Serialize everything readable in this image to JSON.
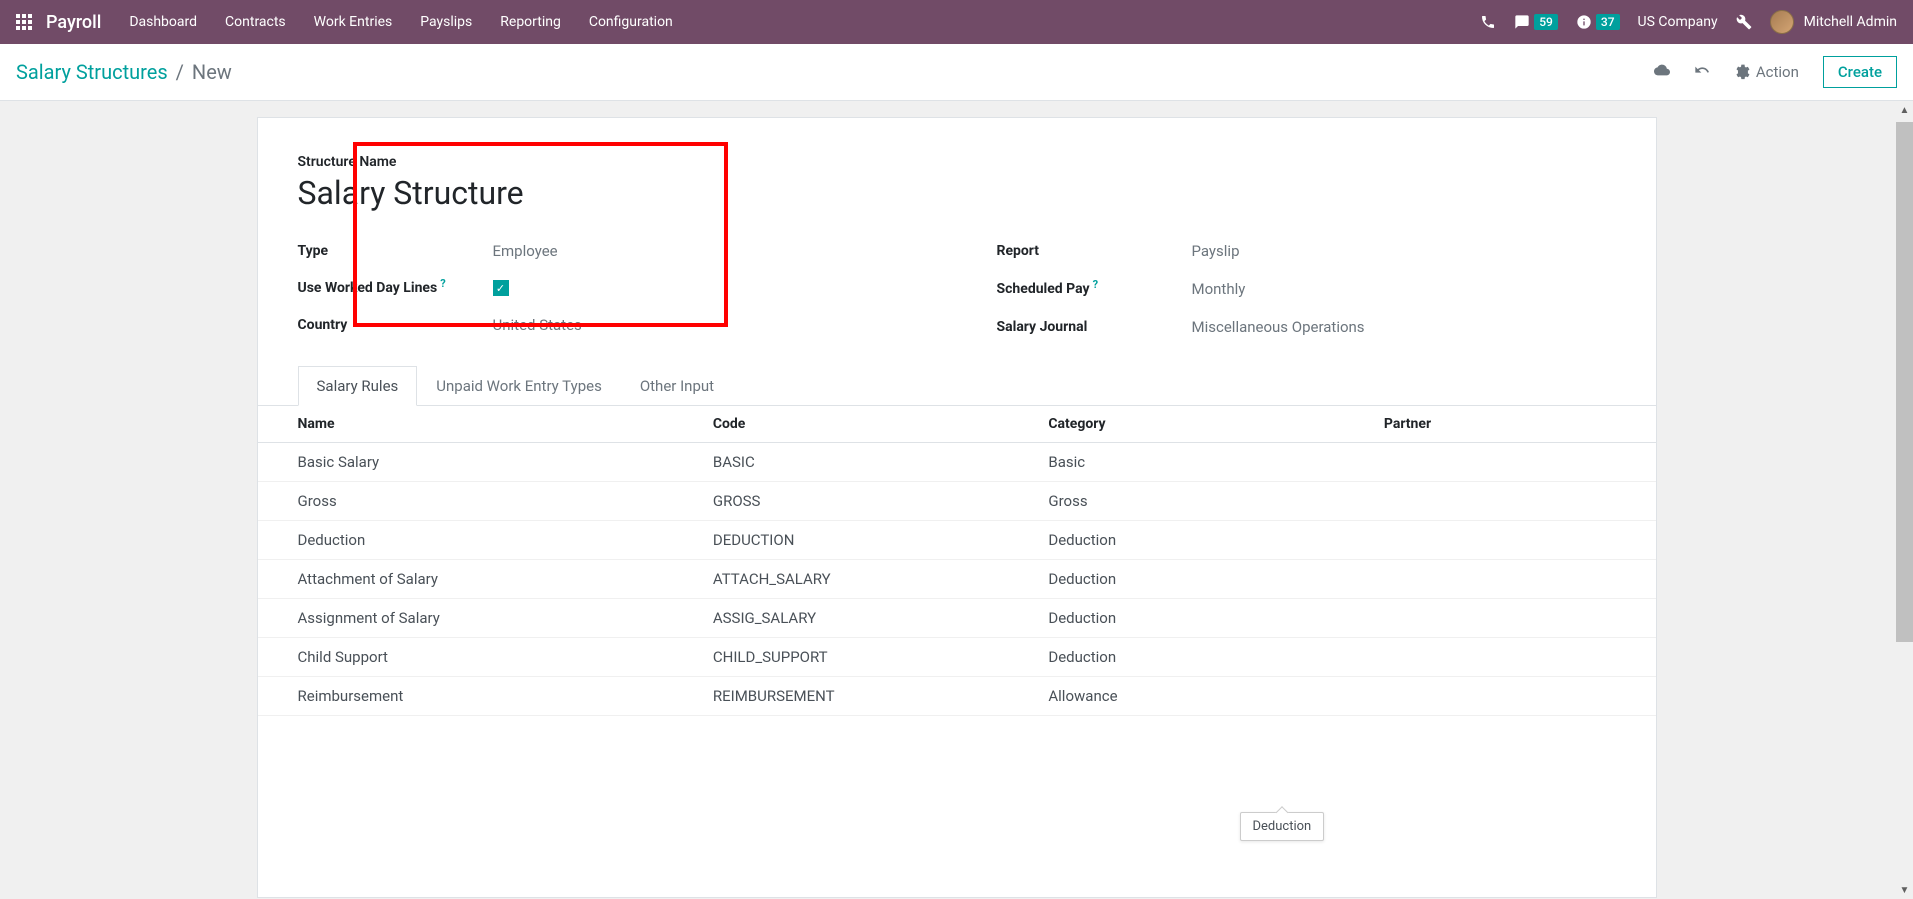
{
  "navbar": {
    "app_name": "Payroll",
    "menu": [
      "Dashboard",
      "Contracts",
      "Work Entries",
      "Payslips",
      "Reporting",
      "Configuration"
    ],
    "messages_count": "59",
    "activities_count": "37",
    "company": "US Company",
    "user_name": "Mitchell Admin"
  },
  "breadcrumb": {
    "parent": "Salary Structures",
    "current": "New"
  },
  "controls": {
    "action_label": "Action",
    "create_label": "Create"
  },
  "form": {
    "structure_name_label": "Structure Name",
    "structure_name": "Salary Structure",
    "type_label": "Type",
    "type_value": "Employee",
    "worked_day_label": "Use Worked Day Lines",
    "worked_day_checked": true,
    "country_label": "Country",
    "country_value": "United States",
    "report_label": "Report",
    "report_value": "Payslip",
    "scheduled_pay_label": "Scheduled Pay",
    "scheduled_pay_value": "Monthly",
    "salary_journal_label": "Salary Journal",
    "salary_journal_value": "Miscellaneous Operations"
  },
  "tabs": [
    "Salary Rules",
    "Unpaid Work Entry Types",
    "Other Input"
  ],
  "table": {
    "headers": {
      "name": "Name",
      "code": "Code",
      "category": "Category",
      "partner": "Partner"
    },
    "rows": [
      {
        "name": "Basic Salary",
        "code": "BASIC",
        "category": "Basic",
        "partner": ""
      },
      {
        "name": "Gross",
        "code": "GROSS",
        "category": "Gross",
        "partner": ""
      },
      {
        "name": "Deduction",
        "code": "DEDUCTION",
        "category": "Deduction",
        "partner": ""
      },
      {
        "name": "Attachment of Salary",
        "code": "ATTACH_SALARY",
        "category": "Deduction",
        "partner": ""
      },
      {
        "name": "Assignment of Salary",
        "code": "ASSIG_SALARY",
        "category": "Deduction",
        "partner": ""
      },
      {
        "name": "Child Support",
        "code": "CHILD_SUPPORT",
        "category": "Deduction",
        "partner": ""
      },
      {
        "name": "Reimbursement",
        "code": "REIMBURSEMENT",
        "category": "Allowance",
        "partner": ""
      }
    ]
  },
  "tooltip": "Deduction"
}
